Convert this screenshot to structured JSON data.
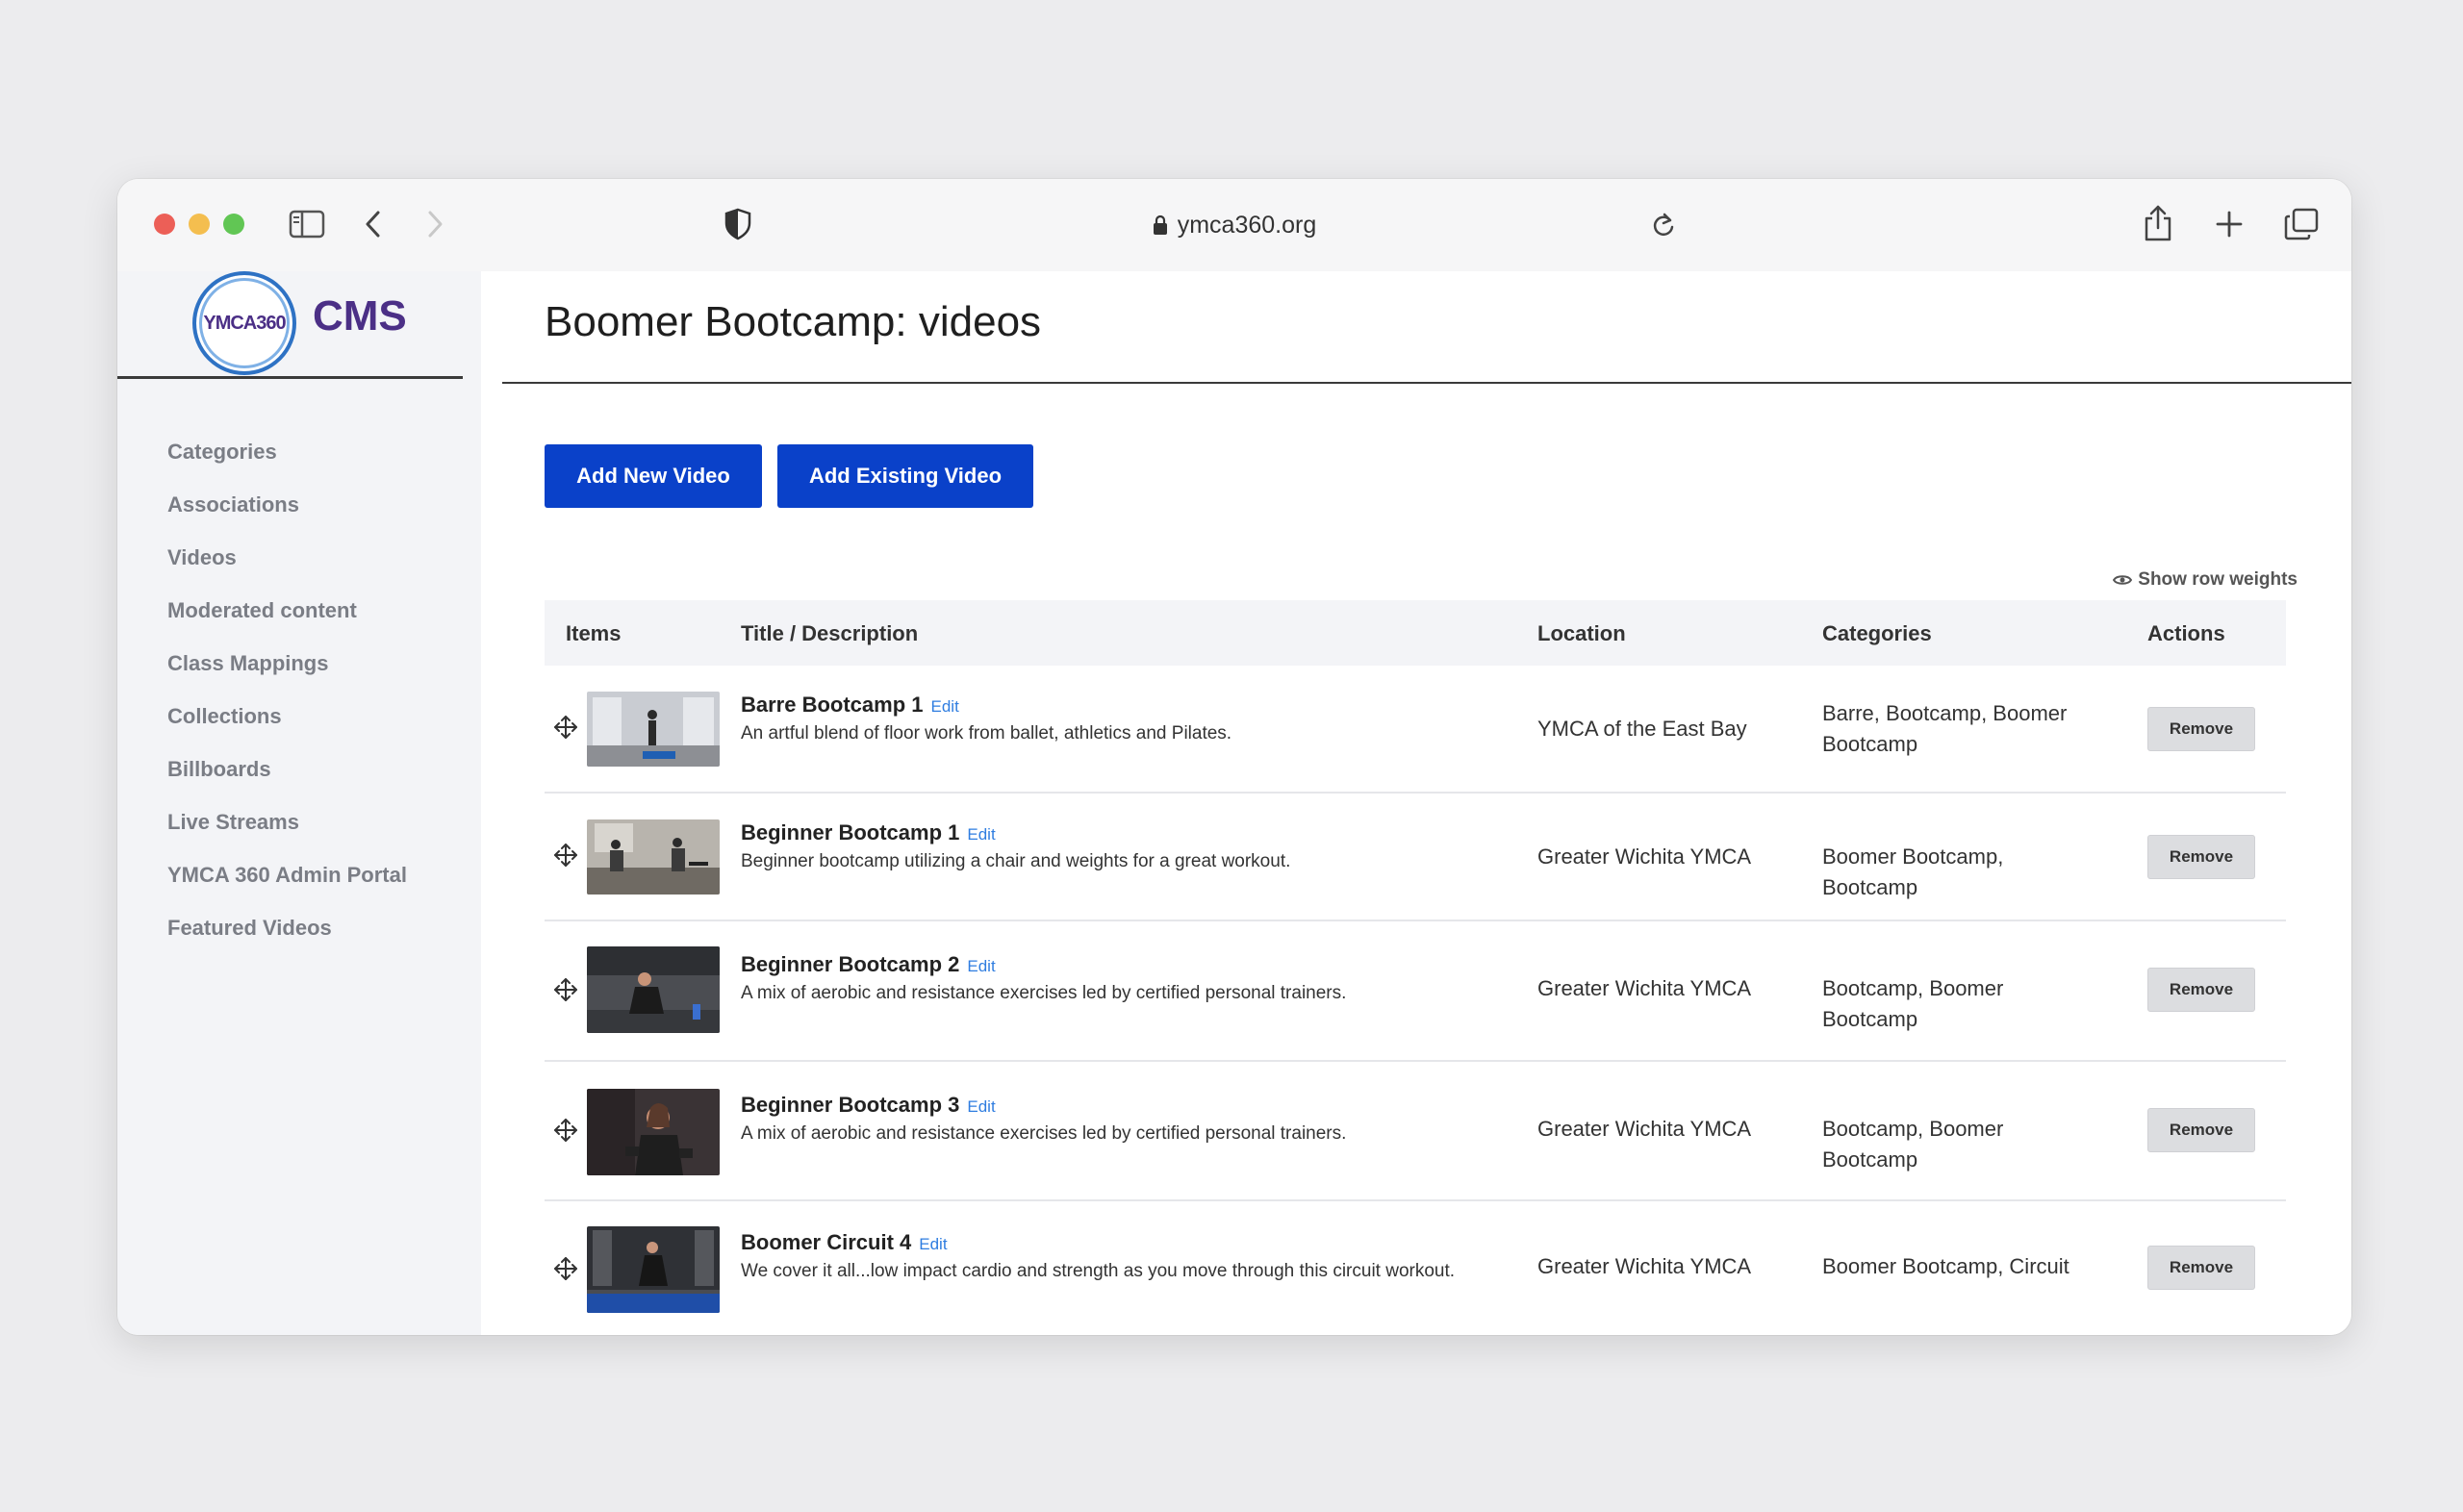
{
  "browser": {
    "url": "ymca360.org"
  },
  "brand": {
    "logo_text": "YMCA360",
    "app_name": "CMS"
  },
  "sidebar": {
    "items": [
      {
        "label": "Categories"
      },
      {
        "label": "Associations"
      },
      {
        "label": "Videos"
      },
      {
        "label": "Moderated content"
      },
      {
        "label": "Class Mappings"
      },
      {
        "label": "Collections"
      },
      {
        "label": "Billboards"
      },
      {
        "label": "Live Streams"
      },
      {
        "label": "YMCA 360 Admin Portal"
      },
      {
        "label": "Featured Videos"
      }
    ]
  },
  "main": {
    "title": "Boomer Bootcamp: videos",
    "add_new_label": "Add New Video",
    "add_existing_label": "Add Existing Video",
    "show_weights_label": "Show row weights"
  },
  "table": {
    "headers": {
      "items": "Items",
      "title": "Title / Description",
      "location": "Location",
      "categories": "Categories",
      "actions": "Actions"
    },
    "edit_label": "Edit",
    "remove_label": "Remove",
    "rows": [
      {
        "title": "Barre Bootcamp 1",
        "description": "An artful blend of floor work from ballet, athletics and Pilates.",
        "location": "YMCA of the East Bay",
        "categories": "Barre, Bootcamp, Boomer Bootcamp"
      },
      {
        "title": "Beginner Bootcamp 1",
        "description": "Beginner bootcamp utilizing a chair and weights for a great workout.",
        "location": "Greater Wichita YMCA",
        "categories": "Boomer Bootcamp, Bootcamp"
      },
      {
        "title": "Beginner Bootcamp 2",
        "description": "A mix of aerobic and resistance exercises led by certified personal trainers.",
        "location": "Greater Wichita YMCA",
        "categories": "Bootcamp, Boomer Bootcamp"
      },
      {
        "title": "Beginner Bootcamp 3",
        "description": "A mix of aerobic and resistance exercises led by certified personal trainers.",
        "location": "Greater Wichita YMCA",
        "categories": "Bootcamp, Boomer Bootcamp"
      },
      {
        "title": "Boomer Circuit 4",
        "description": "We cover it all...low impact cardio and strength as you move through this circuit workout.",
        "location": "Greater Wichita YMCA",
        "categories": "Boomer Bootcamp, Circuit"
      }
    ]
  },
  "colors": {
    "primary_button": "#0a41c9",
    "brand_purple": "#4b2f86",
    "edit_link": "#2f7de0"
  }
}
